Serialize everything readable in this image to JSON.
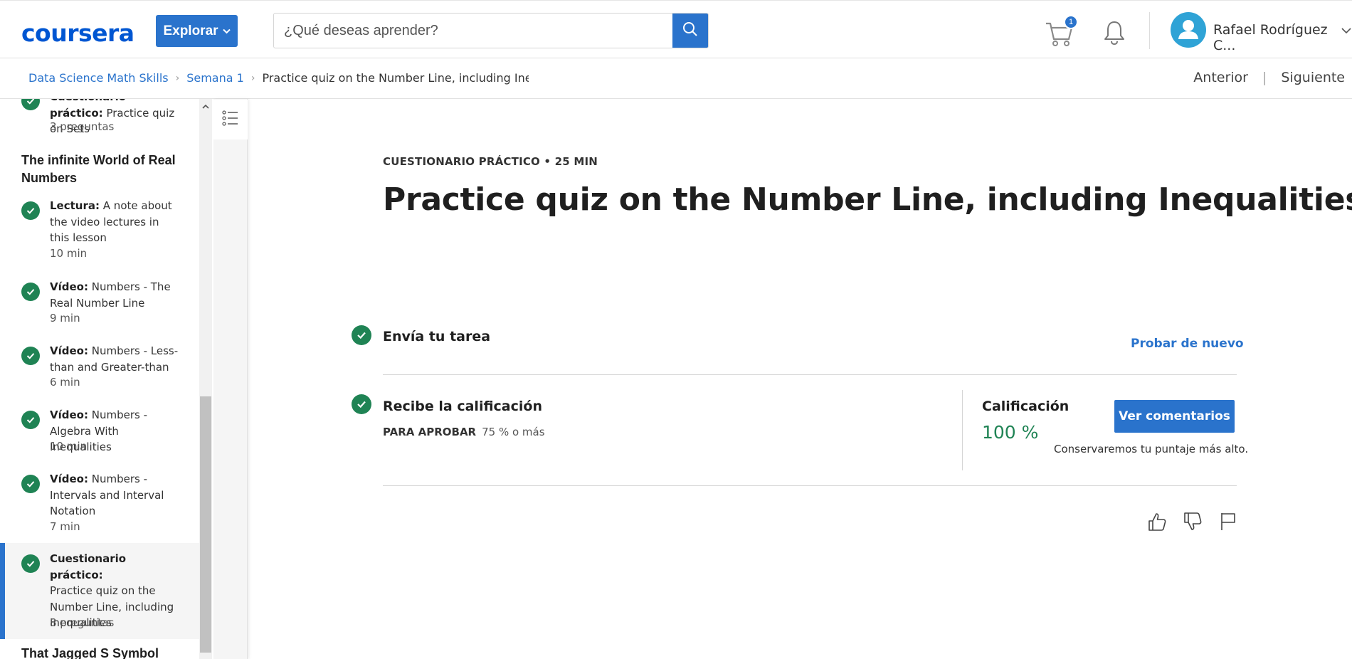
{
  "header": {
    "logo": "coursera",
    "explore_label": "Explorar",
    "search_placeholder": "¿Qué deseas aprender?",
    "cart_count": "1",
    "user_name": "Rafael Rodríguez C...",
    "colors": {
      "brand": "#0056d2",
      "accent": "#2a73cc",
      "success": "#1f8354"
    }
  },
  "breadcrumb": {
    "course": "Data Science Math Skills",
    "week": "Semana 1",
    "current": "Practice quiz on the Number Line, including Inequalities",
    "prev": "Anterior",
    "next": "Siguiente"
  },
  "sidebar": {
    "items": [
      {
        "type": "Cuestionario práctico:",
        "title": "Practice quiz on Sets",
        "meta": "3 preguntas"
      },
      {
        "heading": "The infinite World of Real Numbers"
      },
      {
        "type": "Lectura:",
        "title": "A note about the video lectures in this lesson",
        "meta": "10 min"
      },
      {
        "type": "Vídeo:",
        "title": "Numbers - The Real Number Line",
        "meta": "9 min"
      },
      {
        "type": "Vídeo:",
        "title": "Numbers - Less-than and Greater-than",
        "meta": "6 min"
      },
      {
        "type": "Vídeo:",
        "title": "Numbers - Algebra With Inequalities",
        "meta": "10 min"
      },
      {
        "type": "Vídeo:",
        "title": "Numbers - Intervals and Interval Notation",
        "meta": "7 min"
      },
      {
        "type": "Cuestionario práctico:",
        "title": "Practice quiz on the Number Line, including Inequalities",
        "meta": "8 preguntas"
      },
      {
        "heading": "That Jagged S Symbol"
      }
    ]
  },
  "main": {
    "kicker": "CUESTIONARIO PRÁCTICO • 25 MIN",
    "title": "Practice quiz on the Number Line, including Inequalities",
    "step1_title": "Envía tu tarea",
    "retry_label": "Probar de nuevo",
    "step2_title": "Recibe la calificación",
    "pass_label": "PARA APROBAR",
    "pass_value": "75 % o más",
    "grade_label": "Calificación",
    "grade_value": "100 %",
    "feedback_button": "Ver comentarios",
    "keep_note": "Conservaremos tu puntaje más alto."
  },
  "icons": [
    "search-icon",
    "cart-icon",
    "bell-icon",
    "user-icon",
    "chevron-down-icon",
    "check-icon",
    "list-icon",
    "thumbs-up-icon",
    "thumbs-down-icon",
    "flag-icon"
  ]
}
